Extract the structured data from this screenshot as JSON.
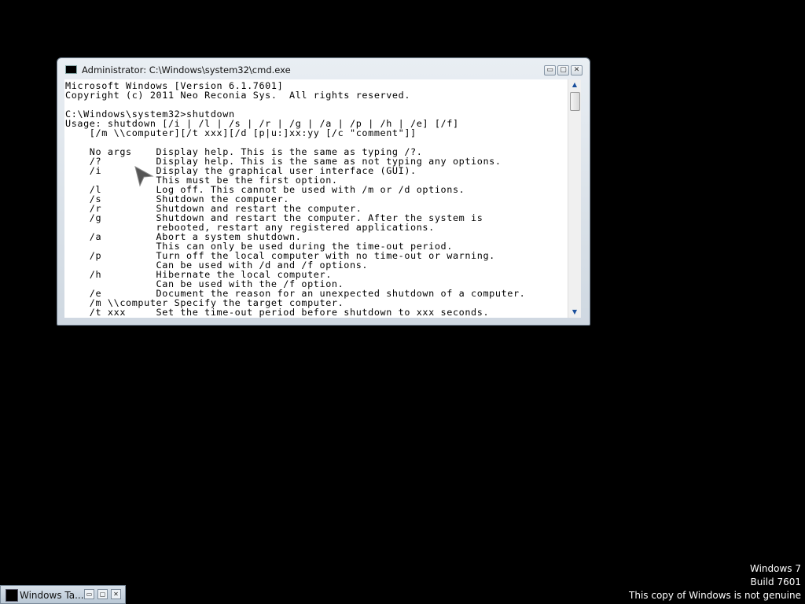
{
  "window": {
    "title": "Administrator: C:\\Windows\\system32\\cmd.exe",
    "minimize_glyph": "▭",
    "maximize_glyph": "▢",
    "close_glyph": "✕"
  },
  "console": {
    "lines": [
      "Microsoft Windows [Version 6.1.7601]",
      "Copyright (c) 2011 Neo Reconia Sys.  All rights reserved.",
      "",
      "C:\\Windows\\system32>shutdown",
      "Usage: shutdown [/i | /l | /s | /r | /g | /a | /p | /h | /e] [/f]",
      "    [/m \\\\computer][/t xxx][/d [p|u:]xx:yy [/c \"comment\"]]",
      "",
      "    No args    Display help. This is the same as typing /?.",
      "    /?         Display help. This is the same as not typing any options.",
      "    /i         Display the graphical user interface (GUI).",
      "               This must be the first option.",
      "    /l         Log off. This cannot be used with /m or /d options.",
      "    /s         Shutdown the computer.",
      "    /r         Shutdown and restart the computer.",
      "    /g         Shutdown and restart the computer. After the system is",
      "               rebooted, restart any registered applications.",
      "    /a         Abort a system shutdown.",
      "               This can only be used during the time-out period.",
      "    /p         Turn off the local computer with no time-out or warning.",
      "               Can be used with /d and /f options.",
      "    /h         Hibernate the local computer.",
      "               Can be used with the /f option.",
      "    /e         Document the reason for an unexpected shutdown of a computer.",
      "    /m \\\\computer Specify the target computer.",
      "    /t xxx     Set the time-out period before shutdown to xxx seconds."
    ]
  },
  "scrollbar": {
    "up_glyph": "▲",
    "down_glyph": "▼"
  },
  "minimized_task": {
    "label": "Windows Ta...",
    "restore_glyph": "▭",
    "maximize_glyph": "▢",
    "close_glyph": "✕"
  },
  "watermark": {
    "line1": "Windows 7",
    "line2": "Build 7601",
    "line3": "This copy of Windows is not genuine"
  }
}
